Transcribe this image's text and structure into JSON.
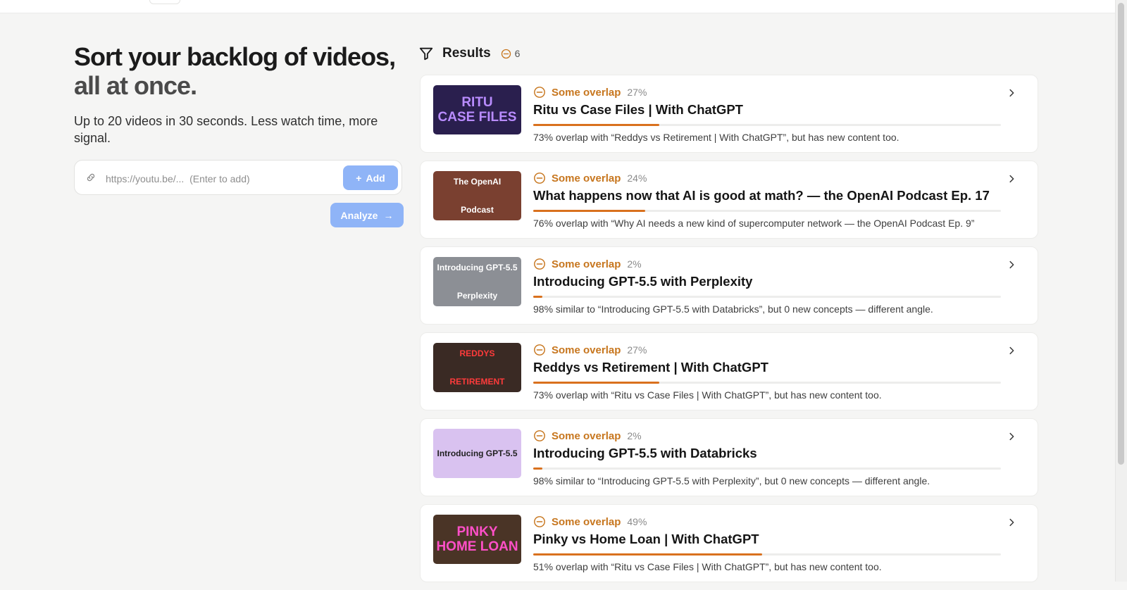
{
  "hero": {
    "title_line1": "Sort your backlog of videos,",
    "title_line2": "all at once.",
    "subtitle": "Up to 20 videos in 30 seconds. Less watch time, more signal."
  },
  "input": {
    "placeholder": "https://youtu.be/...  (Enter to add)",
    "value": "",
    "add_label": "Add",
    "analyze_label": "Analyze"
  },
  "results": {
    "title": "Results",
    "count": "6",
    "items": [
      {
        "status": "Some overlap",
        "percent": "27%",
        "overlap_value": 27,
        "title": "Ritu vs Case Files | With ChatGPT",
        "note": "73% overlap with “Reddys vs Retirement | With ChatGPT”, but has new content too.",
        "thumb_text": [
          "RITU",
          "CASE FILES"
        ],
        "thumb_bg": "#2a1f4e",
        "thumb_color": "#b98cff"
      },
      {
        "status": "Some overlap",
        "percent": "24%",
        "overlap_value": 24,
        "title": "What happens now that AI is good at math? — the OpenAI Podcast Ep. 17",
        "note": "76% overlap with “Why AI needs a new kind of supercomputer network — the OpenAI Podcast Ep. 9”",
        "thumb_text": [
          "The OpenAI",
          "Podcast"
        ],
        "thumb_bg": "#7a4030",
        "thumb_color": "#ffffff"
      },
      {
        "status": "Some overlap",
        "percent": "2%",
        "overlap_value": 2,
        "title": "Introducing GPT-5.5 with Perplexity",
        "note": "98% similar to “Introducing GPT-5.5 with Databricks”, but 0 new concepts — different angle.",
        "thumb_text": [
          "Introducing GPT-5.5",
          "Perplexity"
        ],
        "thumb_bg": "#8c8f95",
        "thumb_color": "#ffffff"
      },
      {
        "status": "Some overlap",
        "percent": "27%",
        "overlap_value": 27,
        "title": "Reddys vs Retirement | With ChatGPT",
        "note": "73% overlap with “Ritu vs Case Files | With ChatGPT”, but has new content too.",
        "thumb_text": [
          "REDDYS",
          "RETIREMENT"
        ],
        "thumb_bg": "#3a2a24",
        "thumb_color": "#ff3b3b"
      },
      {
        "status": "Some overlap",
        "percent": "2%",
        "overlap_value": 2,
        "title": "Introducing GPT-5.5 with Databricks",
        "note": "98% similar to “Introducing GPT-5.5 with Perplexity”, but 0 new concepts — different angle.",
        "thumb_text": [
          "Introducing GPT-5.5"
        ],
        "thumb_bg": "#d9c2f0",
        "thumb_color": "#222222"
      },
      {
        "status": "Some overlap",
        "percent": "49%",
        "overlap_value": 49,
        "title": "Pinky vs Home Loan | With ChatGPT",
        "note": "51% overlap with “Ritu vs Case Files | With ChatGPT”, but has new content too.",
        "thumb_text": [
          "PINKY",
          "HOME LOAN"
        ],
        "thumb_bg": "#4a3426",
        "thumb_color": "#ff4fc8"
      }
    ]
  },
  "colors": {
    "accent_button": "#8fb4f7",
    "overlap_orange": "#c7761e",
    "bar_fill": "#d9711e"
  }
}
